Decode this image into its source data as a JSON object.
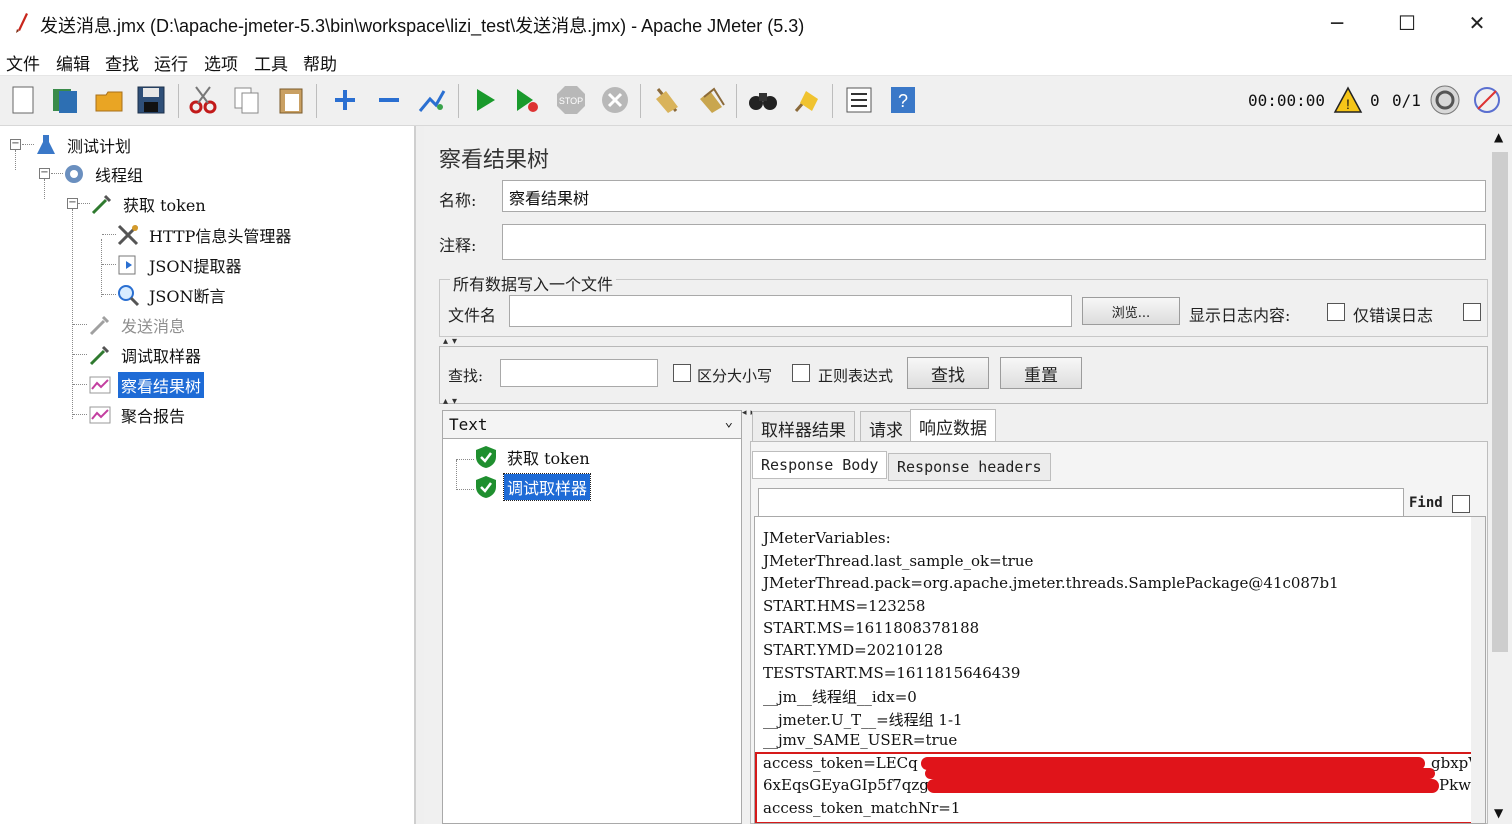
{
  "window": {
    "title": "发送消息.jmx (D:\\apache-jmeter-5.3\\bin\\workspace\\lizi_test\\发送消息.jmx) - Apache JMeter (5.3)",
    "minimize": "─",
    "maximize": "☐",
    "close": "✕"
  },
  "menu": [
    "文件",
    "编辑",
    "查找",
    "运行",
    "选项",
    "工具",
    "帮助"
  ],
  "toolbar": {
    "timer": "00:00:00",
    "warnings": "0",
    "threads": "0/1"
  },
  "tree": {
    "nodes": [
      {
        "label": "测试计划",
        "icon": "flask-icon"
      },
      {
        "label": "线程组",
        "icon": "gear-icon"
      },
      {
        "label": "获取 token",
        "icon": "pipette-icon"
      },
      {
        "label": "HTTP信息头管理器",
        "icon": "tools-icon"
      },
      {
        "label": "JSON提取器",
        "icon": "extract-icon"
      },
      {
        "label": "JSON断言",
        "icon": "magnifier-icon"
      },
      {
        "label": "发送消息",
        "icon": "pipette-icon"
      },
      {
        "label": "调试取样器",
        "icon": "pipette-icon"
      },
      {
        "label": "察看结果树",
        "icon": "graph-icon"
      },
      {
        "label": "聚合报告",
        "icon": "graph-icon"
      }
    ]
  },
  "panel": {
    "title": "察看结果树",
    "name_label": "名称:",
    "name_value": "察看结果树",
    "comment_label": "注释:",
    "comment_value": "",
    "file_group_label": "所有数据写入一个文件",
    "filename_label": "文件名",
    "filename_value": "",
    "browse_button": "浏览...",
    "log_content_label": "显示日志内容:",
    "errors_only_label": "仅错误日志",
    "search_label": "查找:",
    "search_value": "",
    "case_label": "区分大小写",
    "regex_label": "正则表达式",
    "find_button": "查找",
    "reset_button": "重置"
  },
  "results": {
    "renderer": "Text",
    "samples": [
      {
        "label": "获取 token",
        "status": "success"
      },
      {
        "label": "调试取样器",
        "status": "success"
      }
    ]
  },
  "tabs": [
    "取样器结果",
    "请求",
    "响应数据"
  ],
  "subtabs": [
    "Response Body",
    "Response headers"
  ],
  "find": {
    "value": "",
    "label": "Find"
  },
  "response_lines": [
    "JMeterVariables:",
    "JMeterThread.last_sample_ok=true",
    "JMeterThread.pack=org.apache.jmeter.threads.SamplePackage@41c087b1",
    "START.HMS=123258",
    "START.MS=1611808378188",
    "START.YMD=20210128",
    "TESTSTART.MS=1611815646439",
    "__jm__线程组__idx=0",
    "__jmeter.U_T__=线程组 1-1",
    "__jmv_SAME_USER=true",
    "access_token=LECq",
    "6xEqsGEyaGIp5f7qzg",
    "access_token_matchNr=1"
  ],
  "redacted_tails": [
    "gbxpVl",
    "PkwFN"
  ],
  "colors": {
    "selection": "#1e6bd6",
    "redaction": "#e0141a",
    "highlight_box": "#d61a1a"
  }
}
